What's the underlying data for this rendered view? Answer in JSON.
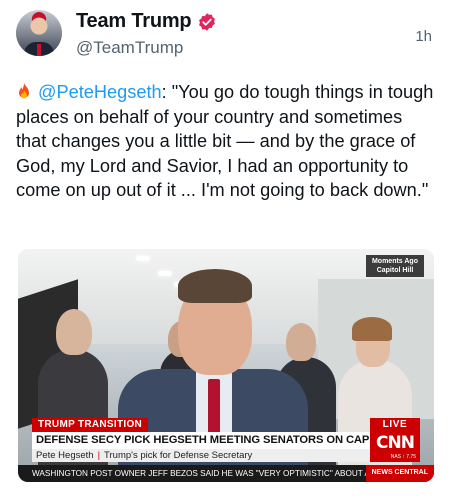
{
  "author": {
    "display_name": "Team Trump",
    "handle": "@TeamTrump",
    "timestamp": "1h",
    "verified_color": "#e0245e"
  },
  "tweet": {
    "emoji_icon": "fire-icon",
    "mention": "@PeteHegseth",
    "body": ": \"You go do tough things in tough places on behalf of your country and sometimes that changes you a little bit — and by the grace of God, my Lord and Savior, I had an opportunity to come on up out of it ... I'm not going to back down.\"",
    "mention_color": "#1d9bf0"
  },
  "video": {
    "corner_badge_line1": "Moments Ago",
    "corner_badge_line2": "Capitol Hill",
    "tag": "TRUMP TRANSITION",
    "live_label": "LIVE",
    "headline": "DEFENSE SECY PICK HEGSETH MEETING SENATORS ON CAPITOL HILL",
    "sub_name": "Pete Hegseth",
    "sub_desc": "Trump's pick for Defense Secretary",
    "network_logo": "CNN",
    "market_value": "NAS ↑ 7.75",
    "ticker_text": "WASHINGTON POST OWNER JEFF BEZOS SAID HE WAS \"VERY OPTIMISTIC\" ABOUT A S",
    "ticker_tag": "NEWS CENTRAL",
    "brand_red": "#cc0000"
  }
}
